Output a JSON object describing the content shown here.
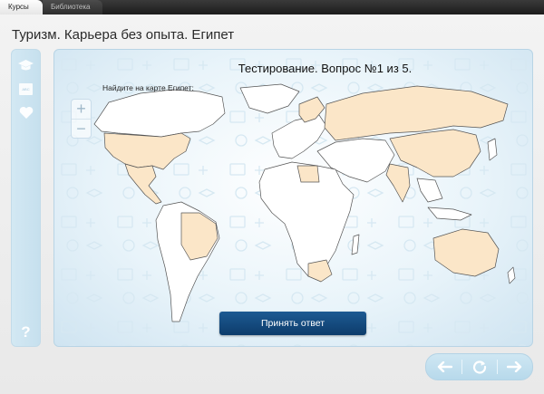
{
  "tabs": [
    {
      "label": "Курсы",
      "active": true
    },
    {
      "label": "Библиотека",
      "active": false
    }
  ],
  "page": {
    "title": "Туризм. Карьера без опыта. Египет"
  },
  "side_toolbar": {
    "items": [
      {
        "name": "graduation-cap-icon"
      },
      {
        "name": "abc-icon",
        "text": "ABC"
      },
      {
        "name": "heart-icon"
      }
    ],
    "help_icon": "?"
  },
  "quiz": {
    "heading": "Тестирование. Вопрос №1 из 5.",
    "prompt": "Найдите на карте Египет:",
    "submit_label": "Принять ответ"
  },
  "map": {
    "zoom_in": "+",
    "zoom_out": "−",
    "land_color": "#ffffff",
    "highlight_color": "#fbe6c8",
    "border_color": "#555555"
  },
  "nav": {
    "prev_icon": "arrow-left-icon",
    "reload_icon": "reload-icon",
    "next_icon": "arrow-right-icon"
  }
}
